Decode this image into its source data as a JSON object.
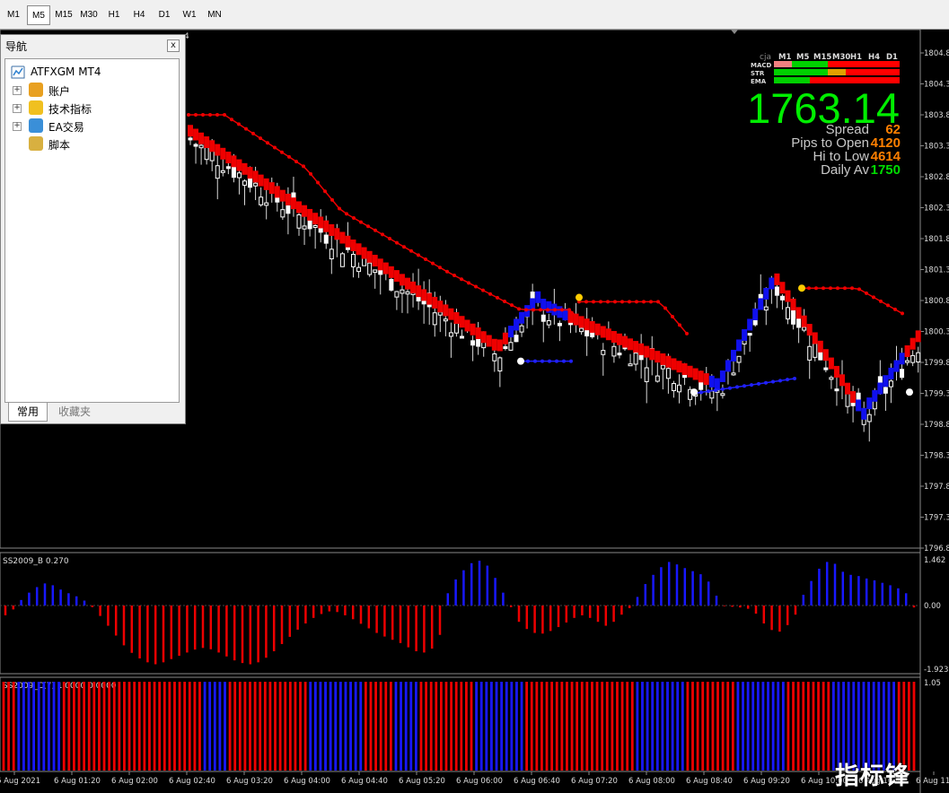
{
  "timeframes": [
    "M1",
    "M5",
    "M15",
    "M30",
    "H1",
    "H4",
    "D1",
    "W1",
    "MN"
  ],
  "active_timeframe": "M5",
  "navigator": {
    "title": "导航",
    "close_label": "x",
    "root": "ATFXGM MT4",
    "items": [
      {
        "label": "账户",
        "icon": "accounts-icon"
      },
      {
        "label": "技术指标",
        "icon": "indicators-icon"
      },
      {
        "label": "EA交易",
        "icon": "expert-advisors-icon"
      },
      {
        "label": "脚本",
        "icon": "scripts-icon"
      }
    ],
    "tabs": [
      "常用",
      "收藏夹"
    ]
  },
  "main_chart": {
    "top_label": "4",
    "price_axis": [
      "1804.8",
      "1804.3",
      "1803.8",
      "1803.3",
      "1802.8",
      "1802.3",
      "1801.8",
      "1801.3",
      "1800.8",
      "1800.3",
      "1799.8",
      "1799.3",
      "1798.8",
      "1798.3",
      "1797.8",
      "1797.3",
      "1796.8"
    ],
    "dashboard": {
      "cja": "cja",
      "tf_headers": [
        "M1",
        "M5",
        "M15",
        "M30",
        "H1",
        "H4",
        "D1"
      ],
      "rows": [
        {
          "label": "MACD",
          "colors": [
            "#f08080",
            "#00d000",
            "#00d000",
            "#ff0000",
            "#ff0000",
            "#ff0000",
            "#ff0000"
          ]
        },
        {
          "label": "STR",
          "colors": [
            "#00d000",
            "#00d000",
            "#00d000",
            "#e0a000",
            "#ff0000",
            "#ff0000",
            "#ff0000"
          ]
        },
        {
          "label": "EMA",
          "colors": [
            "#00d000",
            "#00d000",
            "#ff0000",
            "#ff0000",
            "#ff0000",
            "#ff0000",
            "#ff0000"
          ]
        }
      ],
      "price": "1763.14",
      "stats": [
        {
          "label": "Spread",
          "value": "62",
          "color": "#ff8000"
        },
        {
          "label": "Pips to Open",
          "value": "4120",
          "color": "#ff8000"
        },
        {
          "label": "Hi to Low",
          "value": "4614",
          "color": "#ff8000"
        },
        {
          "label": "Daily Av",
          "value": "1750",
          "color": "#00dd00"
        }
      ]
    }
  },
  "ss2009_b": {
    "label": "SS2009_B 0.270",
    "axis": [
      "1.462",
      "0.00",
      "-1.923"
    ],
    "values": [
      -0.3,
      -0.12,
      0.18,
      0.42,
      0.6,
      0.72,
      0.66,
      0.52,
      0.4,
      0.3,
      0.16,
      -0.05,
      -0.32,
      -0.62,
      -0.92,
      -1.22,
      -1.45,
      -1.62,
      -1.74,
      -1.8,
      -1.74,
      -1.64,
      -1.54,
      -1.44,
      -1.35,
      -1.3,
      -1.34,
      -1.44,
      -1.56,
      -1.68,
      -1.76,
      -1.8,
      -1.74,
      -1.6,
      -1.4,
      -1.18,
      -0.96,
      -0.74,
      -0.55,
      -0.38,
      -0.26,
      -0.18,
      -0.2,
      -0.3,
      -0.42,
      -0.56,
      -0.7,
      -0.84,
      -0.95,
      -1.05,
      -1.15,
      -1.28,
      -1.4,
      -1.44,
      -1.32,
      -0.9,
      0.4,
      0.85,
      1.15,
      1.38,
      1.46,
      1.3,
      0.9,
      0.42,
      -0.05,
      -0.5,
      -0.72,
      -0.84,
      -0.86,
      -0.78,
      -0.66,
      -0.52,
      -0.38,
      -0.3,
      -0.38,
      -0.5,
      -0.62,
      -0.5,
      -0.28,
      -0.08,
      0.28,
      0.7,
      1.0,
      1.25,
      1.42,
      1.34,
      1.22,
      1.12,
      1.02,
      0.78,
      0.32,
      -0.02,
      -0.04,
      -0.06,
      -0.1,
      -0.25,
      -0.55,
      -0.75,
      -0.8,
      -0.6,
      -0.28,
      0.35,
      0.8,
      1.2,
      1.42,
      1.36,
      1.1,
      1.0,
      0.96,
      0.88,
      0.82,
      0.74,
      0.66,
      0.56,
      0.4,
      -0.06
    ]
  },
  "ss2009_c": {
    "label": "SS2009_C(7) 1.0000 0.0000",
    "axis": [
      "1.05"
    ],
    "signals": [
      "r",
      "r",
      "r",
      "b",
      "b",
      "b",
      "b",
      "b",
      "b",
      "b",
      "b",
      "b",
      "r",
      "r",
      "r",
      "r",
      "r",
      "r",
      "r",
      "r",
      "r",
      "r",
      "r",
      "r",
      "r",
      "r",
      "r",
      "r",
      "r",
      "r",
      "r",
      "r",
      "r",
      "r",
      "r",
      "r",
      "r",
      "r",
      "r",
      "r",
      "b",
      "b",
      "b",
      "b",
      "b",
      "r",
      "r",
      "r",
      "r",
      "r",
      "r",
      "r",
      "r",
      "r",
      "r",
      "r",
      "r",
      "r",
      "r",
      "r",
      "r",
      "b",
      "b",
      "b",
      "b",
      "b",
      "b",
      "b",
      "b",
      "b",
      "b",
      "b",
      "r",
      "r",
      "r",
      "r",
      "r",
      "r",
      "b",
      "b",
      "b",
      "b",
      "b",
      "r",
      "r",
      "r",
      "r",
      "r",
      "r",
      "r",
      "r",
      "r",
      "r",
      "r",
      "b",
      "b",
      "b",
      "b",
      "b",
      "b",
      "b",
      "b",
      "b",
      "b",
      "r",
      "r",
      "r",
      "r",
      "r",
      "r",
      "r",
      "r",
      "r",
      "r",
      "r",
      "r",
      "r",
      "r",
      "r",
      "r",
      "r",
      "r",
      "r",
      "r",
      "r",
      "r",
      "b",
      "b",
      "b",
      "b",
      "b",
      "b",
      "b",
      "b",
      "b",
      "b",
      "r",
      "r",
      "r",
      "r",
      "r",
      "r",
      "r",
      "r",
      "r",
      "r",
      "b",
      "b",
      "b",
      "b",
      "b",
      "b",
      "b",
      "b",
      "b",
      "b",
      "r",
      "r",
      "r",
      "r",
      "r",
      "r",
      "r",
      "r",
      "r",
      "b",
      "b",
      "b",
      "b",
      "b",
      "b",
      "b",
      "b",
      "b",
      "b",
      "b",
      "b",
      "b",
      "r",
      "r",
      "r",
      "r"
    ]
  },
  "time_axis": [
    "6 Aug 2021",
    "6 Aug 01:20",
    "6 Aug 02:00",
    "6 Aug 02:40",
    "6 Aug 03:20",
    "6 Aug 04:00",
    "6 Aug 04:40",
    "6 Aug 05:20",
    "6 Aug 06:00",
    "6 Aug 06:40",
    "6 Aug 07:20",
    "6 Aug 08:00",
    "6 Aug 08:40",
    "6 Aug 09:20",
    "6 Aug 10:00",
    "6 Aug 10:40",
    "6 Aug 11"
  ],
  "watermark": "指标锋",
  "colors": {
    "bear": "#ff0000",
    "bull": "#0000ff",
    "candle": "#ffffff",
    "support": "#2020ff"
  }
}
